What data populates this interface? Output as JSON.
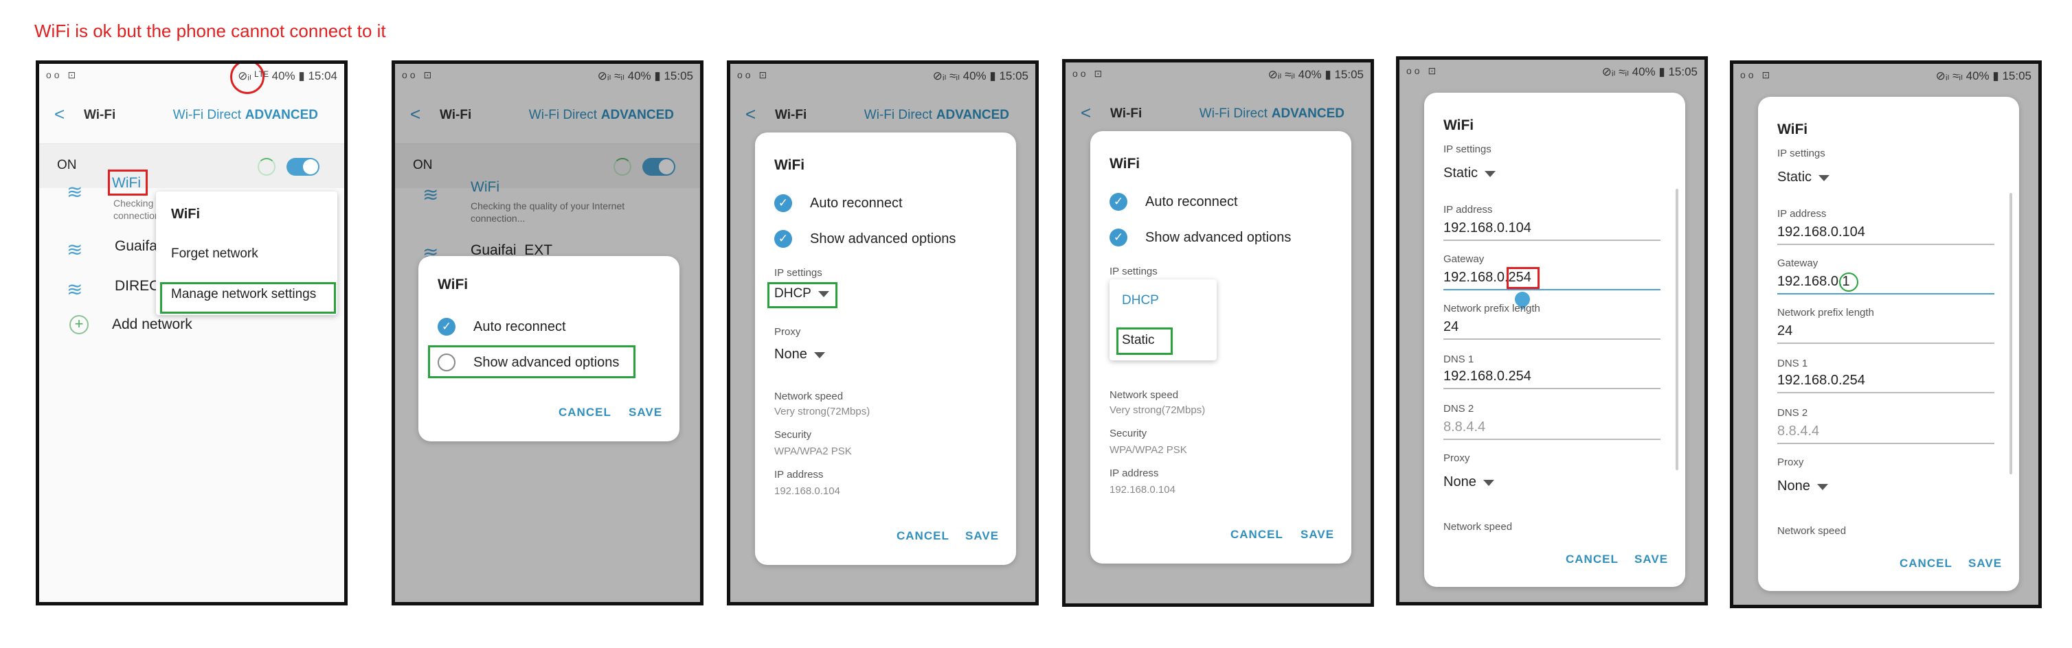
{
  "caption": "WiFi is ok but the phone cannot connect to it",
  "status": {
    "left": "oo ⊡",
    "right_1": "⊘ᵢₗ ᴸᵀᴱ 40% ▮ 15:04",
    "right_n": "⊘ᵢₗ ≈ᵢₗ 40% ▮ 15:05"
  },
  "appbar": {
    "back": "<",
    "title": "Wi-Fi",
    "wifi_direct": "Wi-Fi Direct",
    "advanced": "ADVANCED"
  },
  "on_label": "ON",
  "networks": [
    {
      "name": "WiFi",
      "sub": "Checking the quality of your Internet connection..."
    },
    {
      "name": "Guaifai_EXT"
    },
    {
      "name": "DIRECT-"
    }
  ],
  "networks_short": {
    "guaifai": "Guaifai",
    "direct": "DIRECT-",
    "sub_short": "Checking\nconnection"
  },
  "add_network": "Add network",
  "context_menu": {
    "title": "WiFi",
    "forget": "Forget network",
    "manage": "Manage network settings"
  },
  "dialog": {
    "title": "WiFi",
    "auto_reconnect": "Auto reconnect",
    "show_advanced": "Show advanced options",
    "cancel": "CANCEL",
    "save": "SAVE",
    "ip_settings_label": "IP settings",
    "dhcp": "DHCP",
    "static": "Static",
    "proxy_label": "Proxy",
    "proxy_value": "None",
    "network_speed_label": "Network speed",
    "network_speed_value": "Very strong(72Mbps)",
    "security_label": "Security",
    "security_value": "WPA/WPA2 PSK",
    "ip_address_label": "IP address",
    "ip_address_value": "192.168.0.104",
    "gateway_label": "Gateway",
    "gateway_prefix": "192.168.0.",
    "gateway_suffix_5": "254",
    "gateway_suffix_6": "1",
    "prefix_label": "Network prefix length",
    "prefix_value": "24",
    "dns1_label": "DNS 1",
    "dns1_value": "192.168.0.254",
    "dns2_label": "DNS 2",
    "dns2_value": "8.8.4.4"
  },
  "icons": {
    "wifi": "≋",
    "check": "✓",
    "plus": "+"
  },
  "colors": {
    "accent": "#2f8fbe",
    "highlight_green": "#29a33b",
    "highlight_red": "#e02020"
  }
}
